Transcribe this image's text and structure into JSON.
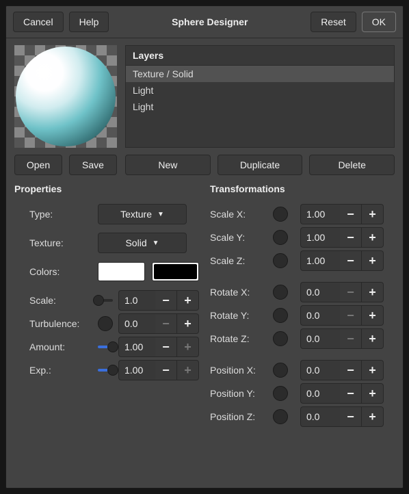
{
  "header": {
    "cancel": "Cancel",
    "help": "Help",
    "title": "Sphere Designer",
    "reset": "Reset",
    "ok": "OK"
  },
  "layers": {
    "label": "Layers",
    "items": [
      "Texture / Solid",
      "Light",
      "Light"
    ],
    "selected_index": 0
  },
  "buttons": {
    "open": "Open",
    "save": "Save",
    "new": "New",
    "duplicate": "Duplicate",
    "delete": "Delete"
  },
  "properties": {
    "title": "Properties",
    "type_label": "Type:",
    "type_value": "Texture",
    "texture_label": "Texture:",
    "texture_value": "Solid",
    "colors_label": "Colors:",
    "color1": "#ffffff",
    "color2": "#000000",
    "scale": {
      "label": "Scale:",
      "value": "1.0",
      "pos": 0.06,
      "fill": 0,
      "minus_dim": false,
      "plus_dim": false
    },
    "turbulence": {
      "label": "Turbulence:",
      "value": "0.0",
      "pos": 1.0,
      "fill": 0,
      "minus_dim": true,
      "plus_dim": false,
      "knob_only": true
    },
    "amount": {
      "label": "Amount:",
      "value": "1.00",
      "pos": 1.0,
      "fill": 1.0,
      "minus_dim": false,
      "plus_dim": true
    },
    "exp": {
      "label": "Exp.:",
      "value": "1.00",
      "pos": 1.0,
      "fill": 1.0,
      "minus_dim": false,
      "plus_dim": true
    }
  },
  "transformations": {
    "title": "Transformations",
    "rows": [
      {
        "label": "Scale X:",
        "value": "1.00",
        "minus_dim": false,
        "plus_dim": false
      },
      {
        "label": "Scale Y:",
        "value": "1.00",
        "minus_dim": false,
        "plus_dim": false
      },
      {
        "label": "Scale Z:",
        "value": "1.00",
        "minus_dim": false,
        "plus_dim": false
      },
      {
        "label": "Rotate X:",
        "value": "0.0",
        "minus_dim": true,
        "plus_dim": false
      },
      {
        "label": "Rotate Y:",
        "value": "0.0",
        "minus_dim": true,
        "plus_dim": false
      },
      {
        "label": "Rotate Z:",
        "value": "0.0",
        "minus_dim": true,
        "plus_dim": false
      },
      {
        "label": "Position X:",
        "value": "0.0",
        "minus_dim": false,
        "plus_dim": false
      },
      {
        "label": "Position Y:",
        "value": "0.0",
        "minus_dim": false,
        "plus_dim": false
      },
      {
        "label": "Position Z:",
        "value": "0.0",
        "minus_dim": false,
        "plus_dim": false
      }
    ]
  }
}
